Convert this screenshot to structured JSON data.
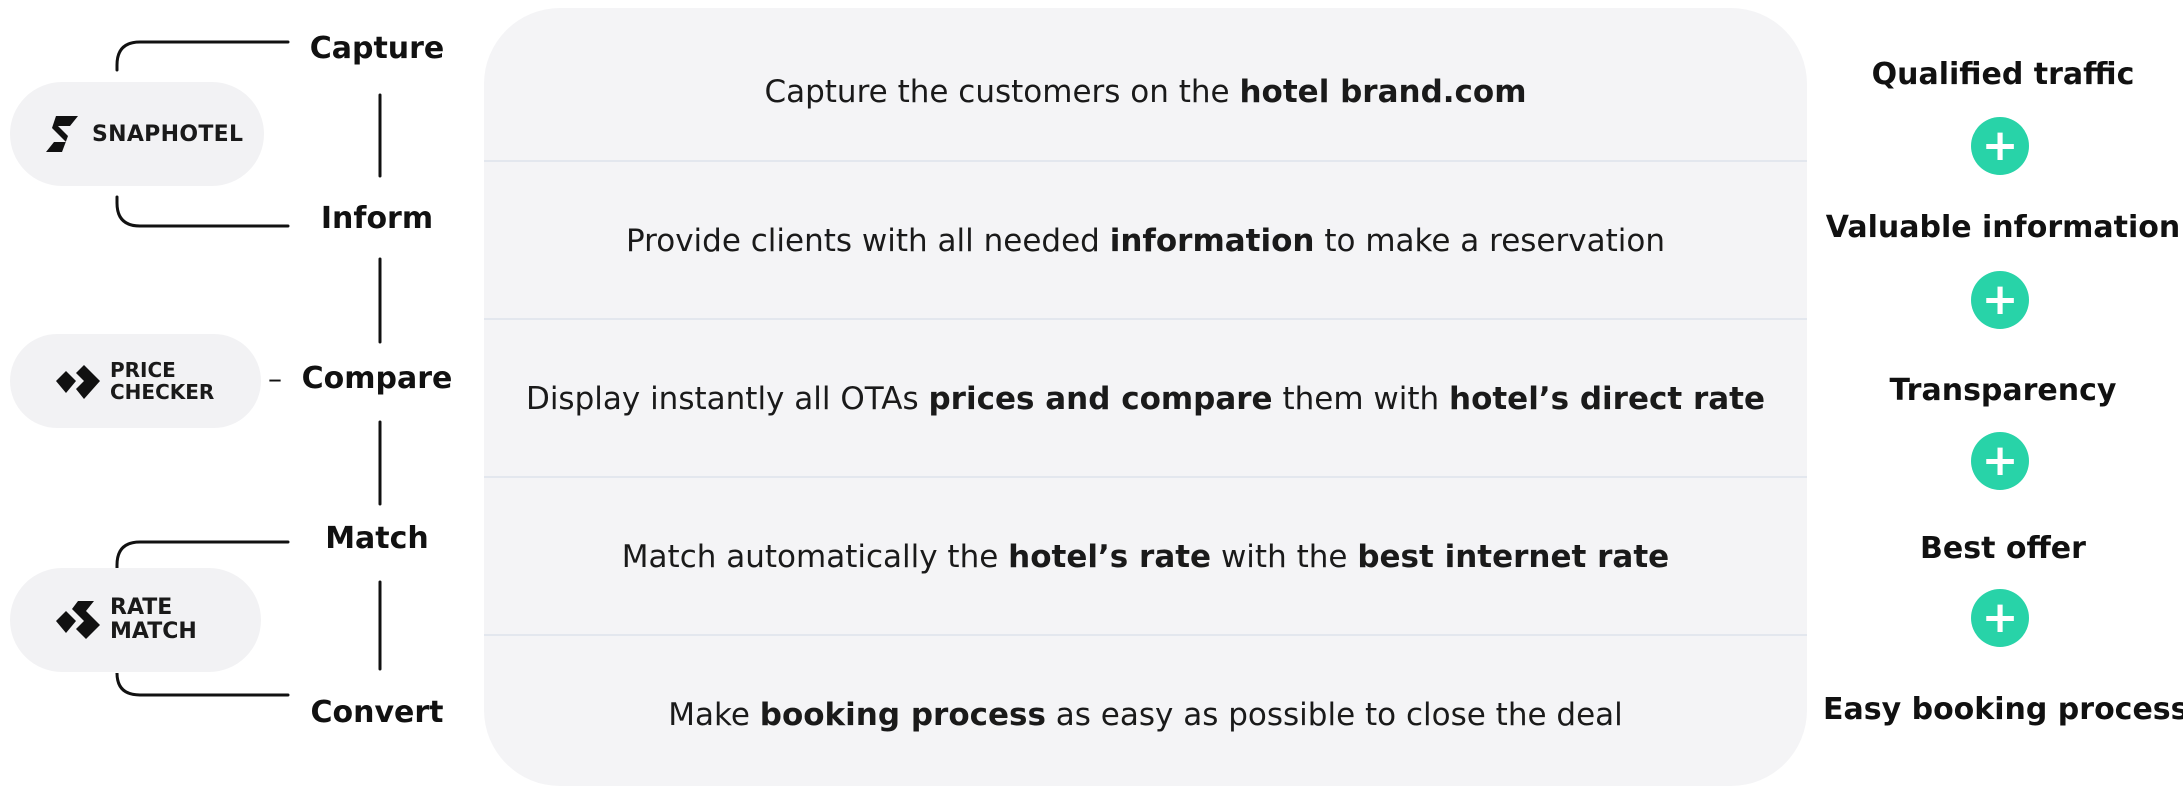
{
  "steps": [
    "Capture",
    "Inform",
    "Compare",
    "Match",
    "Convert"
  ],
  "products": {
    "snaphotel": {
      "name": "SNAPHOTEL",
      "icon": "snaphotel-logo-icon"
    },
    "price_checker": {
      "line1": "PRICE",
      "line2": "CHECKER",
      "icon": "price-checker-logo-icon"
    },
    "rate_match": {
      "line1": "RATE",
      "line2": "MATCH",
      "icon": "rate-match-logo-icon"
    },
    "compare_dash": "–"
  },
  "rows": [
    [
      {
        "t": "Capture the customers on the "
      },
      {
        "t": "hotel brand.com",
        "b": true
      }
    ],
    [
      {
        "t": "Provide clients with all needed "
      },
      {
        "t": "information",
        "b": true
      },
      {
        "t": " to make a reservation"
      }
    ],
    [
      {
        "t": "Display instantly all OTAs "
      },
      {
        "t": "prices and compare",
        "b": true
      },
      {
        "t": " them with "
      },
      {
        "t": "hotel’s direct rate",
        "b": true
      }
    ],
    [
      {
        "t": "Match automatically the "
      },
      {
        "t": "hotel’s rate",
        "b": true
      },
      {
        "t": " with the "
      },
      {
        "t": "best internet rate",
        "b": true
      }
    ],
    [
      {
        "t": "Make "
      },
      {
        "t": "booking process",
        "b": true
      },
      {
        "t": " as easy as possible to close the deal"
      }
    ]
  ],
  "benefits": [
    "Qualified traffic",
    "Valuable information",
    "Transparency",
    "Best offer",
    "Easy booking process"
  ],
  "plus_symbol": "+",
  "colors": {
    "accent": "#28d3a8",
    "panel": "#f4f4f6",
    "pill": "#f2f2f4",
    "text": "#111111"
  }
}
